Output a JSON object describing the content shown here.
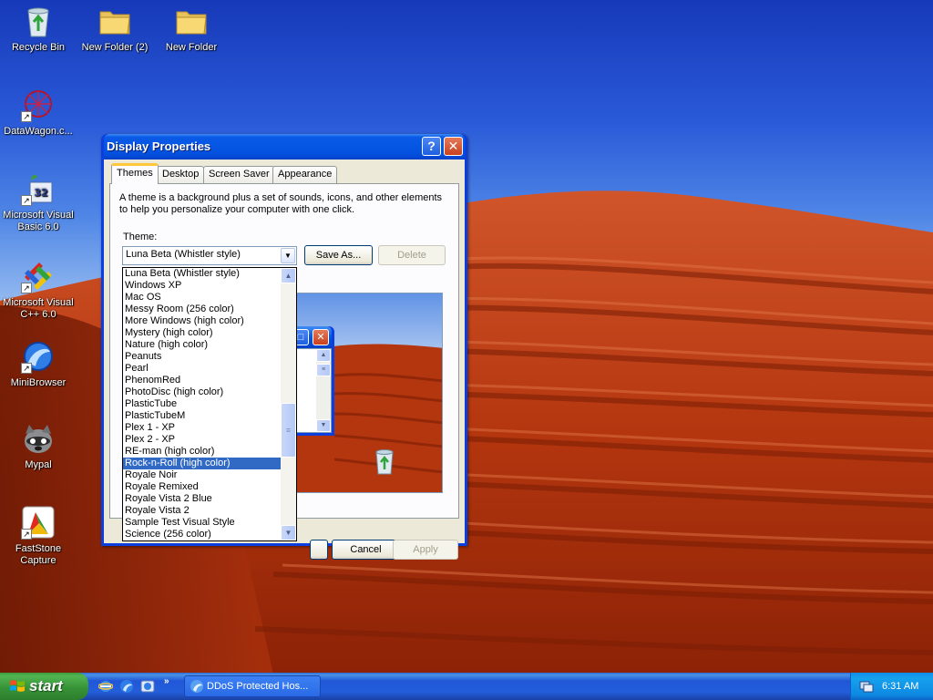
{
  "desktop_icons": [
    {
      "label": "Recycle Bin",
      "icon": "recycle-bin-icon"
    },
    {
      "label": "New Folder (2)",
      "icon": "folder-icon"
    },
    {
      "label": "New Folder",
      "icon": "folder-icon"
    },
    {
      "label": "DataWagon.c...",
      "icon": "datawagon-icon"
    },
    {
      "label": "Microsoft Visual Basic 6.0",
      "icon": "visual-basic-icon"
    },
    {
      "label": "Microsoft Visual C++ 6.0",
      "icon": "visual-cpp-icon"
    },
    {
      "label": "MiniBrowser",
      "icon": "minibrowser-icon"
    },
    {
      "label": "Mypal",
      "icon": "mypal-icon"
    },
    {
      "label": "FastStone Capture",
      "icon": "faststone-capture-icon"
    }
  ],
  "window": {
    "title": "Display Properties",
    "help_label": "?",
    "close_label": "✕",
    "tabs": [
      "Themes",
      "Desktop",
      "Screen Saver",
      "Appearance"
    ],
    "active_tab": "Themes",
    "description": "A theme is a background plus a set of sounds, icons, and other elements to help you personalize your computer with one click.",
    "theme_label": "Theme:",
    "selected_theme": "Luna Beta (Whistler style)",
    "save_as_label": "Save As...",
    "delete_label": "Delete",
    "ok_label": "",
    "cancel_label": "Cancel",
    "apply_label": "Apply"
  },
  "theme_list": {
    "items": [
      "Luna Beta (Whistler style)",
      "Windows XP",
      "Mac OS",
      "Messy Room (256 color)",
      "More Windows (high color)",
      "Mystery (high color)",
      "Nature (high color)",
      "Peanuts",
      "Pearl",
      "PhenomRed",
      "PhotoDisc (high color)",
      "PlasticTube",
      "PlasticTubeM",
      "Plex 1 - XP",
      "Plex 2 - XP",
      "RE-man (high color)",
      "Rock-n-Roll (high color)",
      "Royale Noir",
      "Royale Remixed",
      "Royale Vista 2 Blue",
      "Royale Vista 2",
      "Sample Test Visual Style",
      "Science (256 color)"
    ],
    "highlighted": "Rock-n-Roll (high color)"
  },
  "taskbar": {
    "start_label": "start",
    "quicklaunch_chevron": "»",
    "task_label": "DDoS Protected Hos...",
    "clock": "6:31 AM"
  },
  "colors": {
    "titlebar": "#0556e2",
    "selection": "#316ac5",
    "start_green": "#379337",
    "taskbar_blue": "#245edb",
    "dune_red": "#b4300c"
  }
}
